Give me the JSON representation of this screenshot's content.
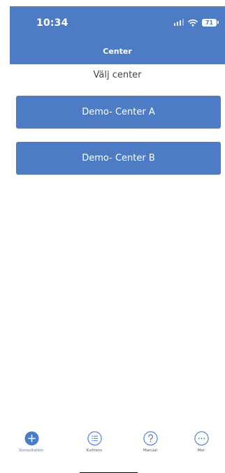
{
  "status_bar": {
    "time": "10:34",
    "battery": "71",
    "icons": [
      "signal-icon",
      "wifi-icon",
      "battery-icon"
    ]
  },
  "header": {
    "title": "Center"
  },
  "main": {
    "prompt": "Välj center",
    "centers": [
      {
        "label": "Demo- Center A"
      },
      {
        "label": "Demo- Center B"
      }
    ]
  },
  "tab_bar": {
    "items": [
      {
        "label": "Konsultation",
        "icon": "plus-circle-icon",
        "active": true
      },
      {
        "label": "Kvittens",
        "icon": "list-icon",
        "active": false
      },
      {
        "label": "Manual",
        "icon": "question-icon",
        "active": false
      },
      {
        "label": "Mer",
        "icon": "more-icon",
        "active": false
      }
    ]
  },
  "colors": {
    "primary": "#4d7cc4",
    "text_muted": "#555555",
    "background": "#ffffff"
  }
}
